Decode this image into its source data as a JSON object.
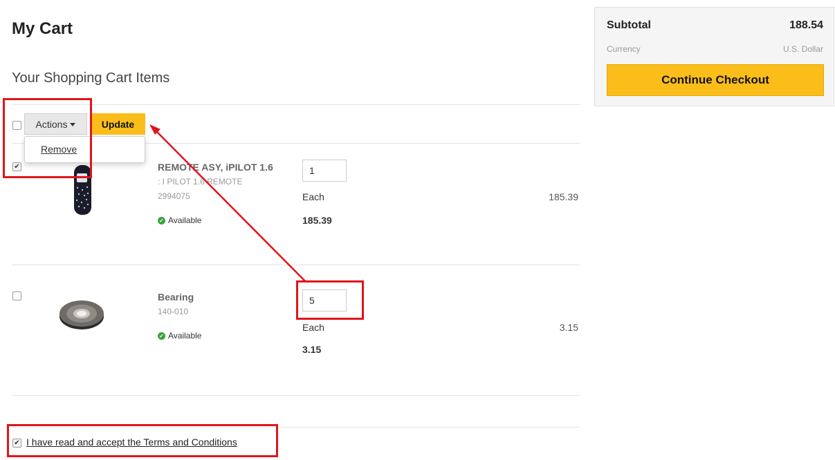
{
  "page": {
    "title": "My Cart",
    "section_title": "Your Shopping Cart Items"
  },
  "toolbar": {
    "actions_label": "Actions",
    "update_label": "Update",
    "select_all_checked": false
  },
  "actions_menu": {
    "items": [
      {
        "label": "Remove"
      }
    ]
  },
  "cart_items": [
    {
      "checked": true,
      "name": "REMOTE ASY, iPILOT 1.6",
      "description": ": I PILOT 1.6 REMOTE",
      "part_number": "2994075",
      "availability": "Available",
      "quantity": "1",
      "uom": "Each",
      "unit_price": "185.39",
      "line_total": "185.39",
      "image_icon": "remote-control-image"
    },
    {
      "checked": false,
      "name": "Bearing",
      "description": "",
      "part_number": "140-010",
      "availability": "Available",
      "quantity": "5",
      "uom": "Each",
      "unit_price": "3.15",
      "line_total": "3.15",
      "image_icon": "bearing-image"
    }
  ],
  "summary": {
    "subtotal_label": "Subtotal",
    "subtotal_value": "188.54",
    "currency_label": "Currency",
    "currency_value": "U.S. Dollar",
    "checkout_label": "Continue Checkout"
  },
  "terms": {
    "checked": true,
    "label": "I have read and accept the Terms and Conditions"
  },
  "colors": {
    "accent": "#fbbd19",
    "annotation": "#e0141b",
    "available": "#3aa53a"
  }
}
